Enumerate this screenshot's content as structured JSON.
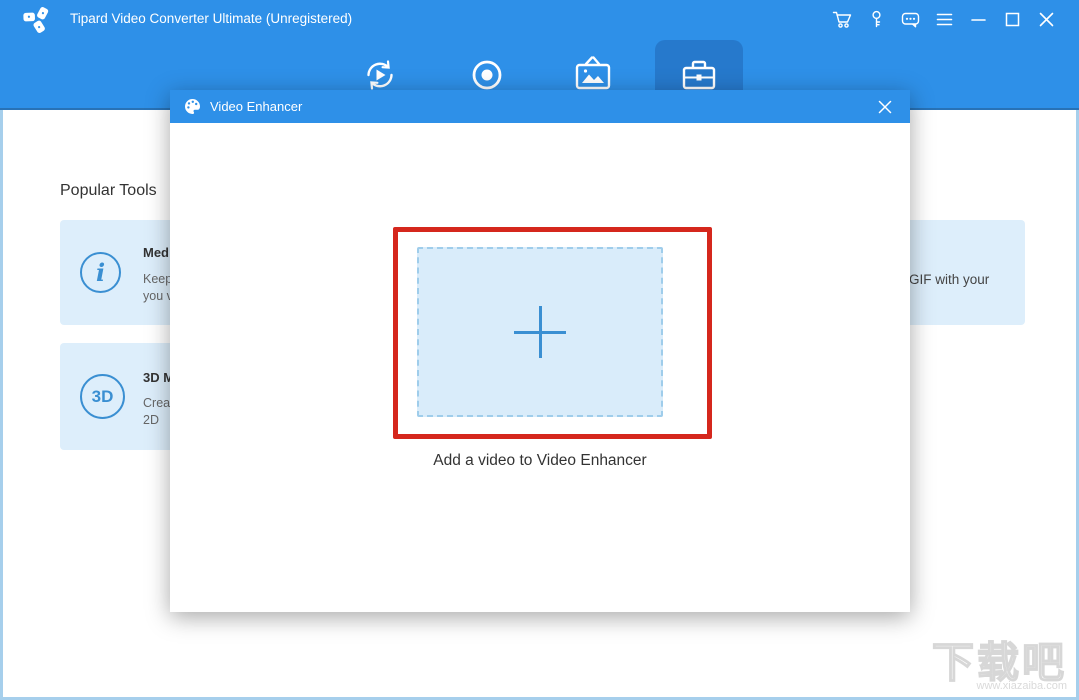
{
  "titlebar": {
    "title": "Tipard Video Converter Ultimate (Unregistered)",
    "icons": [
      "cart-icon",
      "key-icon",
      "feedback-icon",
      "menu-icon",
      "minimize-icon",
      "maximize-icon",
      "close-icon"
    ]
  },
  "tabs": [
    {
      "name": "converter",
      "icon": "convert-icon",
      "selected": false
    },
    {
      "name": "recorder",
      "icon": "record-icon",
      "selected": false
    },
    {
      "name": "mv",
      "icon": "mv-icon",
      "selected": false
    },
    {
      "name": "toolbox",
      "icon": "toolbox-icon",
      "selected": true
    }
  ],
  "popular_tools": {
    "heading": "Popular Tools",
    "cards": [
      {
        "badge": "i",
        "title": "Med",
        "line1": "Keep",
        "line2": "you v"
      },
      {
        "badge": "3D",
        "title": "3D M",
        "line1": "Crea",
        "line2": "2D"
      },
      {
        "badge": "",
        "title": "",
        "line1": "GIF with your"
      }
    ]
  },
  "modal": {
    "title": "Video Enhancer",
    "caption": "Add a video to Video Enhancer"
  },
  "watermark": {
    "brand": "下载吧",
    "site": "www.xiazaiba.com"
  },
  "colors": {
    "accent_blue": "#2e90e8",
    "selected_tab_blue": "#2679cc",
    "highlight_red": "#d5271d",
    "card_bg": "#ddeefb",
    "dropzone_bg": "#d9ecfa",
    "dropzone_border": "#9fcdeb",
    "plus_blue": "#3a8fd2",
    "window_border": "#a6cfec"
  }
}
